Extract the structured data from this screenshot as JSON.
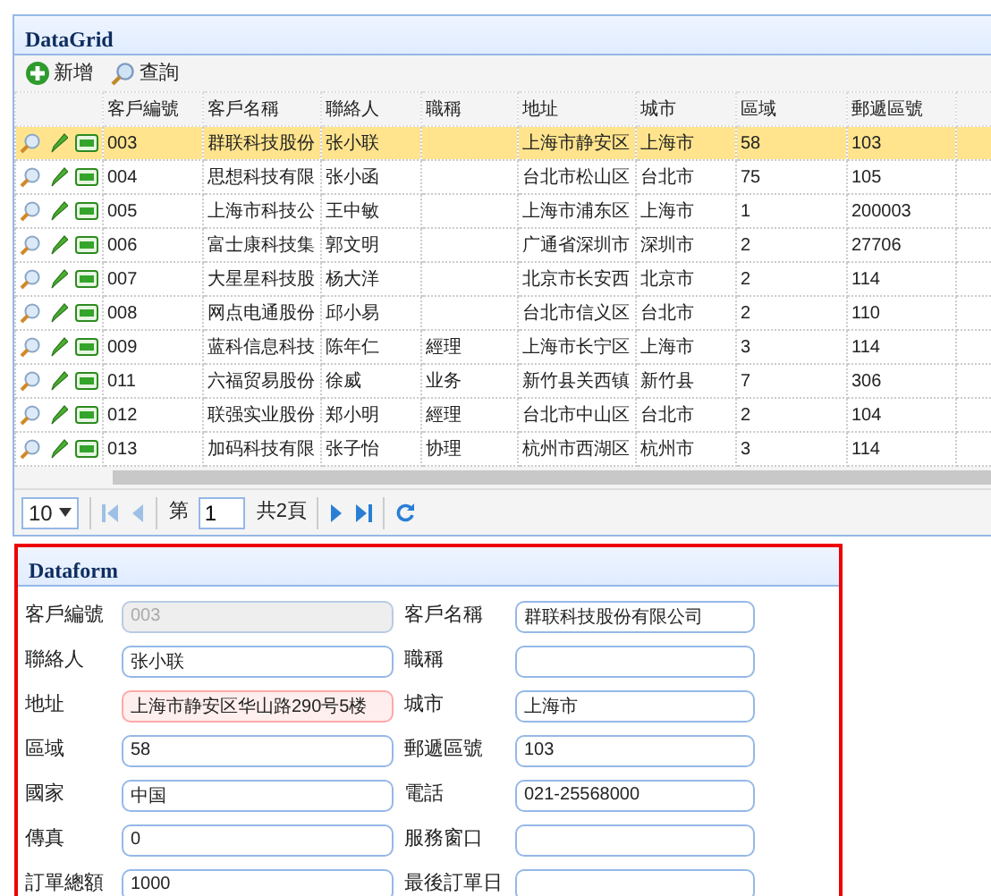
{
  "grid": {
    "title": "DataGrid",
    "toolbar": [
      {
        "kind": "add",
        "label": "新增"
      },
      {
        "kind": "search",
        "label": "查詢"
      }
    ],
    "columns": [
      "客戶編號",
      "客戶名稱",
      "聯絡人",
      "職稱",
      "地址",
      "城市",
      "區域",
      "郵遞區號"
    ],
    "rows": [
      {
        "selected": true,
        "cells": [
          "003",
          "群联科技股份",
          "张小联",
          "",
          "上海市静安区",
          "上海市",
          "58",
          "103"
        ]
      },
      {
        "selected": false,
        "cells": [
          "004",
          "思想科技有限",
          "张小函",
          "",
          "台北市松山区",
          "台北市",
          "75",
          "105"
        ]
      },
      {
        "selected": false,
        "cells": [
          "005",
          "上海市科技公",
          "王中敏",
          "",
          "上海市浦东区",
          "上海市",
          "1",
          "200003"
        ]
      },
      {
        "selected": false,
        "cells": [
          "006",
          "富士康科技集",
          "郭文明",
          "",
          "广通省深圳市",
          "深圳市",
          "2",
          "27706"
        ]
      },
      {
        "selected": false,
        "cells": [
          "007",
          "大星星科技股",
          "杨大洋",
          "",
          "北京市长安西",
          "北京市",
          "2",
          "114"
        ]
      },
      {
        "selected": false,
        "cells": [
          "008",
          "网点电通股份",
          "邱小易",
          "",
          "台北市信义区",
          "台北市",
          "2",
          "110"
        ]
      },
      {
        "selected": false,
        "cells": [
          "009",
          "蓝科信息科技",
          "陈年仁",
          "經理",
          "上海市长宁区",
          "上海市",
          "3",
          "114"
        ]
      },
      {
        "selected": false,
        "cells": [
          "011",
          "六福贸易股份",
          "徐威",
          "业务",
          "新竹县关西镇",
          "新竹县",
          "7",
          "306"
        ]
      },
      {
        "selected": false,
        "cells": [
          "012",
          "联强实业股份",
          "郑小明",
          "經理",
          "台北市中山区",
          "台北市",
          "2",
          "104"
        ]
      },
      {
        "selected": false,
        "cells": [
          "013",
          "加码科技有限",
          "张子怡",
          "协理",
          "杭州市西湖区",
          "杭州市",
          "3",
          "114"
        ]
      }
    ],
    "pager": {
      "page_size": "10",
      "page_prefix": "第",
      "page": "1",
      "page_total": "共2頁"
    }
  },
  "form": {
    "title": "Dataform",
    "fields": [
      {
        "label": "客戶編號",
        "value": "003",
        "disabled": true,
        "invalid": false
      },
      {
        "label": "客戶名稱",
        "value": "群联科技股份有限公司",
        "disabled": false,
        "invalid": false
      },
      {
        "label": "聯絡人",
        "value": "张小联",
        "disabled": false,
        "invalid": false
      },
      {
        "label": "職稱",
        "disabled": false,
        "invalid": false
      },
      {
        "label": "地址",
        "value": "上海市静安区华山路290号5楼",
        "disabled": false,
        "invalid": true
      },
      {
        "label": "城市",
        "value": "上海市",
        "disabled": false,
        "invalid": false
      },
      {
        "label": "區域",
        "value": "58",
        "disabled": false,
        "invalid": false
      },
      {
        "label": "郵遞區號",
        "value": "103",
        "disabled": false,
        "invalid": false
      },
      {
        "label": "國家",
        "value": "中国",
        "disabled": false,
        "invalid": false
      },
      {
        "label": "電話",
        "value": "021-25568000",
        "disabled": false,
        "invalid": false
      },
      {
        "label": "傳真",
        "value": "0",
        "disabled": false,
        "invalid": false
      },
      {
        "label": "服務窗口",
        "disabled": false,
        "invalid": false
      },
      {
        "label": "訂單總額",
        "value": "1000",
        "disabled": false,
        "invalid": false
      },
      {
        "label": "最後訂單日",
        "disabled": false,
        "invalid": false
      }
    ]
  }
}
